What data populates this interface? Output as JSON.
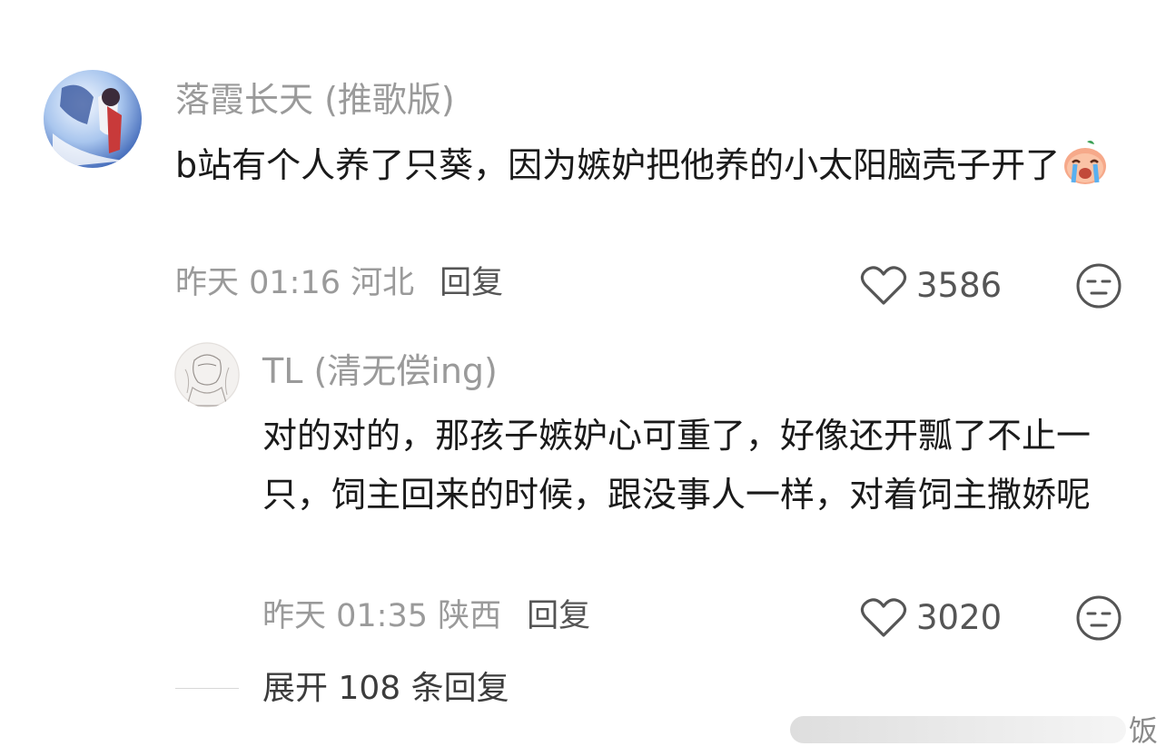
{
  "comment": {
    "username": "落霞长天 (推歌版)",
    "text": "b站有个人养了只葵，因为嫉妒把他养的小太阳脑壳子开了",
    "emoji": "crying-face-emoji",
    "time": "昨天 01:16 河北",
    "reply_label": "回复",
    "likes": "3586"
  },
  "reply": {
    "username": "TL (清无偿ing)",
    "text": "对的对的，那孩子嫉妒心可重了，好像还开瓢了不止一只，饲主回来的时候，跟没事人一样，对着饲主撒娇呢",
    "time": "昨天 01:35 陕西",
    "reply_label": "回复",
    "likes": "3020"
  },
  "expand_label": "展开 108 条回复",
  "watermark_glyph": "饭",
  "icons": {
    "like": "heart-outline-icon",
    "dislike": "neutral-face-icon"
  },
  "colors": {
    "username": "#9a9a9a",
    "text": "#1a1a1a",
    "meta": "#9a9a9a"
  }
}
